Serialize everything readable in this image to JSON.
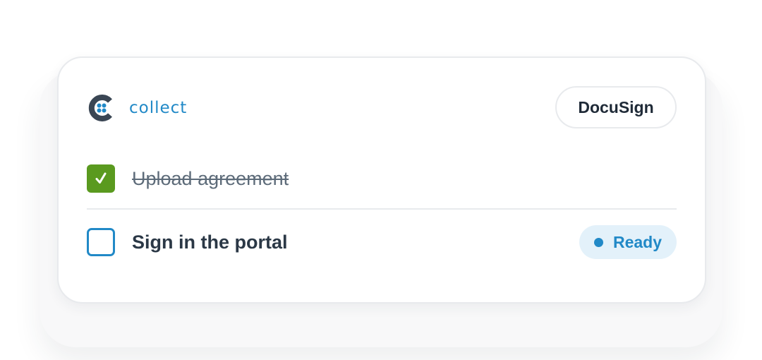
{
  "brand": {
    "name": "collect",
    "icon": "collect-logo-icon",
    "color": "#2189c7"
  },
  "header": {
    "docusign_label": "DocuSign"
  },
  "tasks": [
    {
      "label": "Upload agreement",
      "checked": true,
      "check_color": "#5a9a1f"
    },
    {
      "label": "Sign in the portal",
      "checked": false,
      "status": "Ready",
      "status_color": "#2189c7"
    }
  ]
}
